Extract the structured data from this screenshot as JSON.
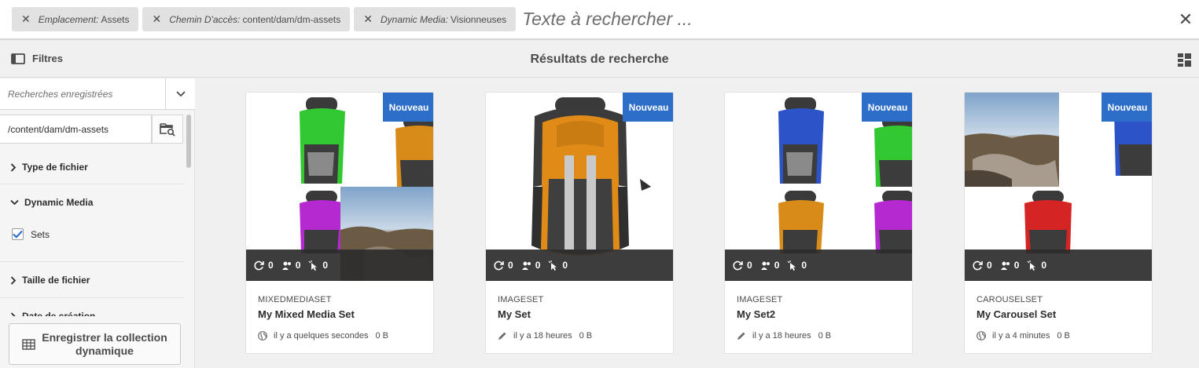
{
  "search": {
    "chips": [
      {
        "key": "Emplacement:",
        "value": "Assets"
      },
      {
        "key": "Chemin D'accès:",
        "value": "content/dam/dm-assets"
      },
      {
        "key": "Dynamic Media:",
        "value": "Visionneuses"
      }
    ],
    "placeholder": "Texte à rechercher ..."
  },
  "actionbar": {
    "filters_label": "Filtres",
    "title": "Résultats de recherche"
  },
  "rail": {
    "saved_searches_placeholder": "Recherches enregistrées",
    "path": "/content/dam/dm-assets",
    "facets": {
      "file_type": "Type de fichier",
      "dynamic_media": "Dynamic Media",
      "sets": "Sets",
      "file_size": "Taille de fichier",
      "created": "Date de création"
    },
    "save_collection": "Enregistrer la collection dynamique"
  },
  "icons": {
    "chip_remove": "close-icon",
    "search_close": "close-icon",
    "filters": "sidebar-toggle-icon",
    "view": "grid-view-icon",
    "dropdown": "chevron-down-icon",
    "browse": "folder-search-icon",
    "collapsed": "chevron-right-icon",
    "expanded": "chevron-down-icon",
    "save_collection": "table-icon"
  },
  "colors": {
    "badge": "#2d6ec9",
    "checkbox_accent": "#2d6ec9"
  },
  "cards": [
    {
      "badge": "Nouveau",
      "type": "MIXEDMEDIASET",
      "title": "My Mixed Media Set",
      "status_icon": "globe-icon",
      "time": "il y a quelques secondes",
      "size": "0 B",
      "stats": [
        "0",
        "0",
        "0"
      ]
    },
    {
      "badge": "Nouveau",
      "type": "IMAGESET",
      "title": "My Set",
      "status_icon": "pencil-icon",
      "time": "il y a 18 heures",
      "size": "0 B",
      "stats": [
        "0",
        "0",
        "0"
      ]
    },
    {
      "badge": "Nouveau",
      "type": "IMAGESET",
      "title": "My Set2",
      "status_icon": "pencil-icon",
      "time": "il y a 18 heures",
      "size": "0 B",
      "stats": [
        "0",
        "0",
        "0"
      ]
    },
    {
      "badge": "Nouveau",
      "type": "CAROUSELSET",
      "title": "My Carousel Set",
      "status_icon": "globe-icon",
      "time": "il y a 4 minutes",
      "size": "0 B",
      "stats": [
        "0",
        "0",
        "0"
      ]
    }
  ]
}
